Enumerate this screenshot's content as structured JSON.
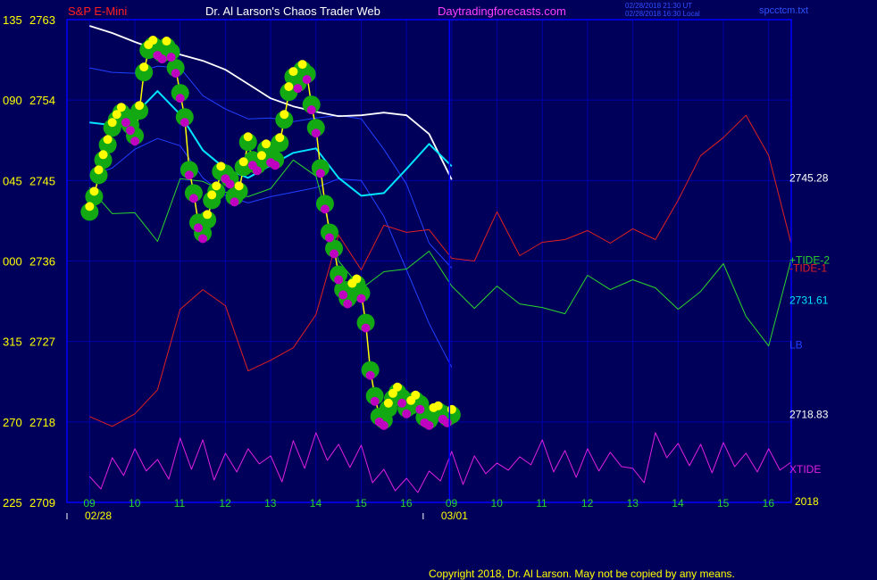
{
  "header": {
    "instrument": "S&P E-Mini",
    "site_title": "Dr. Al Larson's Chaos Trader Web",
    "site_url": "Daytradingforecasts.com",
    "stamp_line1": "02/28/2018 21:30 UT",
    "stamp_line2": "02/28/2018 16:30 Local",
    "filename": "spcctcm.txt"
  },
  "footer": {
    "copyright": "Copyright 2018, Dr. Al Larson. May not be copied by any means."
  },
  "colors": {
    "background": "#00005a",
    "grid": "#0000aa",
    "axis": "#0000ff",
    "price": "#ffff00",
    "cyan": "#00e5ff",
    "white": "#ffffff",
    "green_tide": "#2bd62b",
    "red_tide": "#e02020",
    "xtide": "#e020e0",
    "blue": "#2040ff",
    "dot_green": "#13a913",
    "dot_yellow": "#ffff00",
    "dot_magenta": "#c000c0"
  },
  "chart_data": {
    "type": "line",
    "title": "S&P E-Mini",
    "y_left_labels": [
      {
        "left": "135",
        "price": "2763"
      },
      {
        "left": "090",
        "price": "2754"
      },
      {
        "left": "045",
        "price": "2745"
      },
      {
        "left": "000",
        "price": "2736"
      },
      {
        "left": "315",
        "price": "2727"
      },
      {
        "left": "270",
        "price": "2718"
      },
      {
        "left": "225",
        "price": "2709"
      }
    ],
    "ylim": [
      2709,
      2763
    ],
    "x_hour_labels": [
      "09",
      "10",
      "11",
      "12",
      "13",
      "14",
      "15",
      "16",
      "09",
      "10",
      "11",
      "12",
      "13",
      "14",
      "15",
      "16"
    ],
    "x_date_labels": [
      "02/28",
      "03/01"
    ],
    "year_label": "2018",
    "right_labels": [
      {
        "text": "2745.28",
        "value": 2745.28,
        "color": "#ffffff"
      },
      {
        "text": "+TIDE-2",
        "value": 2736.1,
        "color": "#2bd62b"
      },
      {
        "text": "-TIDE-1",
        "value": 2735.2,
        "color": "#e02020"
      },
      {
        "text": "2731.61",
        "value": 2731.61,
        "color": "#00e5ff"
      },
      {
        "text": "LB",
        "value": 2726.6,
        "color": "#2040ff"
      },
      {
        "text": "2718.83",
        "value": 2718.83,
        "color": "#ffffff"
      },
      {
        "text": "XTIDE",
        "value": 2712.7,
        "color": "#e020e0"
      }
    ],
    "price_series": {
      "x": [
        0,
        0.1,
        0.2,
        0.3,
        0.4,
        0.5,
        0.6,
        0.7,
        0.8,
        0.9,
        1.0,
        1.1,
        1.2,
        1.3,
        1.4,
        1.5,
        1.6,
        1.7,
        1.8,
        1.9,
        2.0,
        2.1,
        2.2,
        2.3,
        2.4,
        2.5,
        2.6,
        2.7,
        2.8,
        2.9,
        3.0,
        3.1,
        3.2,
        3.3,
        3.4,
        3.5,
        3.6,
        3.7,
        3.8,
        3.9,
        4.0,
        4.1,
        4.2,
        4.3,
        4.4,
        4.5,
        4.6,
        4.7,
        4.8,
        4.9,
        5.0,
        5.1,
        5.2,
        5.3,
        5.4,
        5.5,
        5.6,
        5.7,
        5.8,
        5.9,
        6.0,
        6.1,
        6.2,
        6.3,
        6.4,
        6.5,
        6.6,
        6.7,
        6.8,
        6.9,
        7.0,
        7.1,
        7.2,
        7.3,
        7.4,
        7.5,
        7.6,
        7.7,
        7.8,
        7.9,
        8.0
      ],
      "y": [
        2741.5,
        2743.2,
        2745.6,
        2747.3,
        2749.0,
        2750.9,
        2751.8,
        2752.6,
        2752.1,
        2751.2,
        2750.0,
        2752.8,
        2757.1,
        2759.6,
        2760.1,
        2759.6,
        2759.2,
        2760.0,
        2759.4,
        2757.6,
        2754.8,
        2752.1,
        2746.2,
        2743.6,
        2740.3,
        2739.1,
        2740.6,
        2742.8,
        2743.8,
        2746.0,
        2745.8,
        2745.2,
        2743.2,
        2743.8,
        2746.5,
        2749.3,
        2747.3,
        2746.7,
        2747.2,
        2748.5,
        2747.6,
        2747.3,
        2749.2,
        2751.8,
        2754.9,
        2756.6,
        2755.9,
        2757.4,
        2756.9,
        2753.5,
        2750.9,
        2746.4,
        2742.4,
        2739.2,
        2737.4,
        2734.5,
        2732.8,
        2731.8,
        2732.9,
        2733.4,
        2732.4,
        2729.1,
        2723.8,
        2720.9,
        2718.6,
        2718.2,
        2719.5,
        2720.6,
        2721.3,
        2720.7,
        2719.5,
        2719.8,
        2720.4,
        2720.0,
        2718.5,
        2718.2,
        2719.0,
        2719.2,
        2718.9,
        2718.5,
        2718.8
      ]
    },
    "cyan_series": {
      "x": [
        0,
        0.5,
        1.0,
        1.5,
        2.0,
        2.5,
        3.0,
        3.5,
        4.0,
        4.5,
        5.0,
        5.5,
        6.0,
        6.5,
        7.0,
        7.5,
        8.0
      ],
      "y": [
        2751.5,
        2751.2,
        2752.4,
        2755.0,
        2752.4,
        2748.4,
        2746.3,
        2745.3,
        2746.7,
        2748.1,
        2748.6,
        2745.3,
        2743.3,
        2743.6,
        2746.3,
        2749.1,
        2746.6
      ]
    },
    "green_tide": {
      "x": [
        0,
        0.5,
        1.0,
        1.5,
        2.0,
        2.5,
        3.0,
        3.5,
        4.0,
        4.5,
        5.0,
        5.5,
        6.0,
        6.5,
        7.0,
        7.5,
        8.0,
        8.5,
        9.0,
        9.5,
        10.0,
        10.5,
        11.0,
        11.5,
        12.0,
        12.5,
        13.0,
        13.5,
        14.0,
        14.5,
        15.0,
        15.5
      ],
      "y": [
        2744.2,
        2741.3,
        2741.4,
        2738.2,
        2745.2,
        2744.9,
        2743.7,
        2743.2,
        2744.1,
        2747.3,
        2745.5,
        2736.0,
        2732.9,
        2734.8,
        2735.1,
        2737.1,
        2733.2,
        2730.7,
        2733.2,
        2731.2,
        2730.8,
        2730.1,
        2734.4,
        2732.8,
        2733.9,
        2733.0,
        2730.6,
        2732.6,
        2735.7,
        2729.8,
        2726.5,
        2736.2
      ]
    },
    "red_tide": {
      "x": [
        0,
        0.5,
        1.0,
        1.5,
        2.0,
        2.5,
        3.0,
        3.5,
        4.0,
        4.5,
        5.0,
        5.5,
        6.0,
        6.5,
        7.0,
        7.5,
        8.0,
        8.5,
        9.0,
        9.5,
        10.0,
        10.5,
        11.0,
        11.5,
        12.0,
        12.5,
        13.0,
        13.5,
        14.0,
        14.5,
        15.0,
        15.5
      ],
      "y": [
        2718.6,
        2717.5,
        2718.9,
        2721.6,
        2730.6,
        2732.8,
        2731.0,
        2723.7,
        2724.9,
        2726.3,
        2730.0,
        2738.9,
        2735.0,
        2740.0,
        2739.2,
        2739.5,
        2736.3,
        2736.0,
        2741.5,
        2736.6,
        2738.1,
        2738.4,
        2739.4,
        2738.0,
        2739.6,
        2738.4,
        2742.8,
        2747.8,
        2749.8,
        2752.3,
        2747.8,
        2737.9
      ]
    },
    "xtide": {
      "x": [
        0,
        0.25,
        0.5,
        0.75,
        1.0,
        1.25,
        1.5,
        1.75,
        2.0,
        2.25,
        2.5,
        2.75,
        3.0,
        3.25,
        3.5,
        3.75,
        4.0,
        4.25,
        4.5,
        4.75,
        5.0,
        5.25,
        5.5,
        5.75,
        6.0,
        6.25,
        6.5,
        6.75,
        7.0,
        7.25,
        7.5,
        7.75,
        8.0,
        8.25,
        8.5,
        8.75,
        9.0,
        9.25,
        9.5,
        9.75,
        10.0,
        10.25,
        10.5,
        10.75,
        11.0,
        11.25,
        11.5,
        11.75,
        12.0,
        12.25,
        12.5,
        12.75,
        13.0,
        13.25,
        13.5,
        13.75,
        14.0,
        14.25,
        14.5,
        14.75,
        15.0,
        15.25,
        15.5
      ],
      "y": [
        2711.9,
        2710.5,
        2714.0,
        2712.0,
        2715.0,
        2712.5,
        2713.8,
        2711.6,
        2716.2,
        2712.7,
        2716.0,
        2711.5,
        2714.5,
        2712.4,
        2715.0,
        2713.3,
        2714.2,
        2711.3,
        2715.9,
        2712.8,
        2716.8,
        2713.7,
        2715.5,
        2712.9,
        2715.4,
        2711.2,
        2712.7,
        2710.3,
        2711.7,
        2710.1,
        2712.5,
        2711.4,
        2714.7,
        2711.0,
        2714.2,
        2712.2,
        2713.4,
        2712.6,
        2714.1,
        2713.2,
        2716.0,
        2712.4,
        2714.8,
        2711.8,
        2715.0,
        2712.5,
        2714.6,
        2713.0,
        2712.8,
        2711.2,
        2716.8,
        2714.0,
        2715.6,
        2713.1,
        2715.5,
        2712.3,
        2715.7,
        2713.0,
        2714.5,
        2712.4,
        2715.0,
        2712.6,
        2713.5
      ]
    },
    "white_line": {
      "x": [
        0,
        0.5,
        1.0,
        1.5,
        2.0,
        2.5,
        3.0,
        3.5,
        4.0,
        4.5,
        5.0,
        5.5,
        6.0,
        6.5,
        7.0,
        7.5,
        8.0
      ],
      "y": [
        2762.3,
        2761.5,
        2760.5,
        2759.6,
        2759.1,
        2758.4,
        2757.4,
        2755.8,
        2754.2,
        2753.3,
        2752.7,
        2752.2,
        2752.3,
        2752.6,
        2752.3,
        2750.2,
        2745.1
      ]
    },
    "blue_upper": {
      "x": [
        0,
        0.5,
        1.0,
        1.5,
        2.0,
        2.5,
        3.0,
        3.5,
        4.0,
        4.5,
        5.0,
        5.5,
        6.0,
        6.5,
        7.0,
        7.5,
        8.0
      ],
      "y": [
        2757.6,
        2757.1,
        2757.0,
        2757.8,
        2757.6,
        2754.5,
        2753.0,
        2751.9,
        2752.0,
        2751.6,
        2752.0,
        2752.3,
        2751.9,
        2748.5,
        2744.6,
        2738.0,
        2735.2
      ]
    },
    "blue_lower": {
      "x": [
        0,
        0.5,
        1.0,
        1.5,
        2.0,
        2.5,
        3.0,
        3.5,
        4.0,
        4.5,
        5.0,
        5.5,
        6.0,
        6.5,
        7.0,
        7.5,
        8.0
      ],
      "y": [
        2745.5,
        2746.4,
        2748.5,
        2749.7,
        2748.9,
        2745.3,
        2743.3,
        2742.5,
        2743.2,
        2743.7,
        2744.2,
        2745.2,
        2745.0,
        2741.0,
        2735.0,
        2729.0,
        2724.1
      ]
    }
  }
}
